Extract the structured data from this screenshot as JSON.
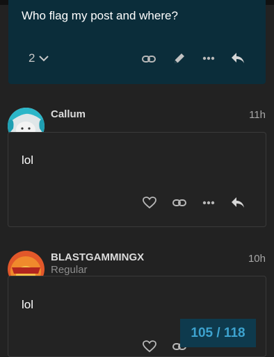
{
  "own_post": {
    "text": "Who flag my post and where?",
    "reply_count": "2"
  },
  "posts": [
    {
      "username": "Callum",
      "time": "11h",
      "body": "lol"
    },
    {
      "username": "BLASTGAMMINGX",
      "user_title": "Regular",
      "time": "10h",
      "body": "lol"
    }
  ],
  "progress": {
    "label": "105 / 118",
    "current": 105,
    "total": 118
  },
  "icons": [
    "chevron-down-icon",
    "link-icon",
    "pencil-icon",
    "more-icon",
    "reply-icon",
    "heart-icon",
    "avatar"
  ],
  "colors": {
    "background": "#222222",
    "own_post_bg": "#0b2d3a",
    "accent": "#3da3cf"
  }
}
